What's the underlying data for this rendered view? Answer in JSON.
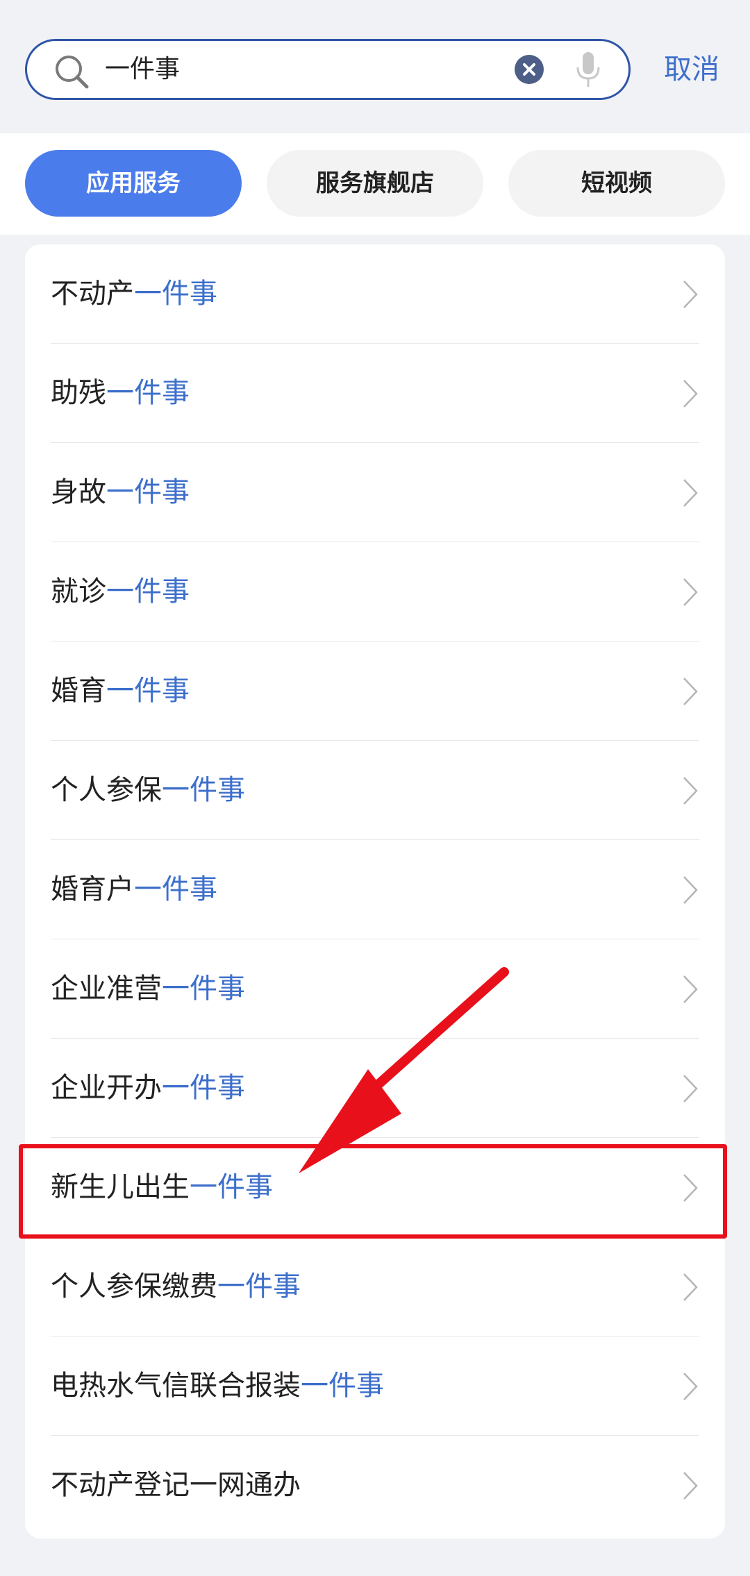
{
  "search": {
    "query": "一件事",
    "cancel_label": "取消"
  },
  "tabs": [
    {
      "label": "应用服务",
      "active": true
    },
    {
      "label": "服务旗舰店",
      "active": false
    },
    {
      "label": "短视频",
      "active": false
    }
  ],
  "results": [
    {
      "prefix": "不动产",
      "highlight": "一件事"
    },
    {
      "prefix": "助残",
      "highlight": "一件事"
    },
    {
      "prefix": "身故",
      "highlight": "一件事"
    },
    {
      "prefix": "就诊",
      "highlight": "一件事"
    },
    {
      "prefix": "婚育",
      "highlight": "一件事"
    },
    {
      "prefix": "个人参保",
      "highlight": "一件事"
    },
    {
      "prefix": "婚育户",
      "highlight": "一件事"
    },
    {
      "prefix": "企业准营",
      "highlight": "一件事"
    },
    {
      "prefix": "企业开办",
      "highlight": "一件事"
    },
    {
      "prefix": "新生儿出生",
      "highlight": "一件事"
    },
    {
      "prefix": "个人参保缴费",
      "highlight": "一件事"
    },
    {
      "prefix": "电热水气信联合报装",
      "highlight": "一件事"
    },
    {
      "prefix": "不动产登记一网通办",
      "highlight": ""
    }
  ],
  "colors": {
    "accent": "#4a7cec",
    "link": "#3d6fcb",
    "annotation": "#e8111b"
  }
}
